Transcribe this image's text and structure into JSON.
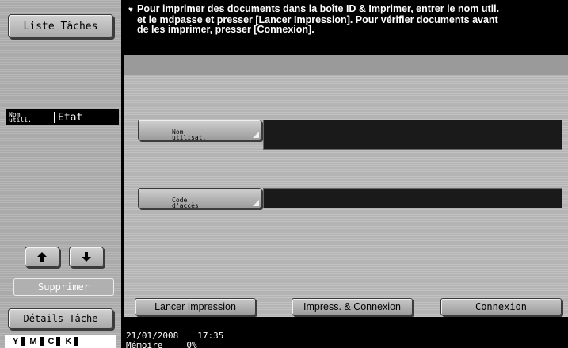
{
  "left_panel": {
    "job_list_button": "Liste Tâches",
    "jobs_header": {
      "user_label": "Nom\nutili.",
      "state_label": "Etat"
    },
    "delete_button": "Supprimer",
    "job_details_button": "Détails Tâche",
    "toner": [
      {
        "color": "Y"
      },
      {
        "color": "M"
      },
      {
        "color": "C"
      },
      {
        "color": "K"
      }
    ]
  },
  "message": {
    "line1": "Pour imprimer des documents dans la boîte ID & Imprimer, entrer le nom util.",
    "line2": "et le mdpasse et presser [Lancer Impression]. Pour vérifier documents avant",
    "line3": "de les imprimer, presser [Connexion]."
  },
  "form": {
    "user_button_label": "Nom\nutilisat.",
    "user_value": "",
    "code_button_label": "Code\nd'accès",
    "code_value": ""
  },
  "actions": {
    "print": "Lancer Impression",
    "print_and_connect": "Impress. & Connexion",
    "connect": "Connexion"
  },
  "status": {
    "date": "21/01/2008",
    "time": "17:35",
    "memory_label": "Mémoire",
    "memory_value": "0%"
  }
}
